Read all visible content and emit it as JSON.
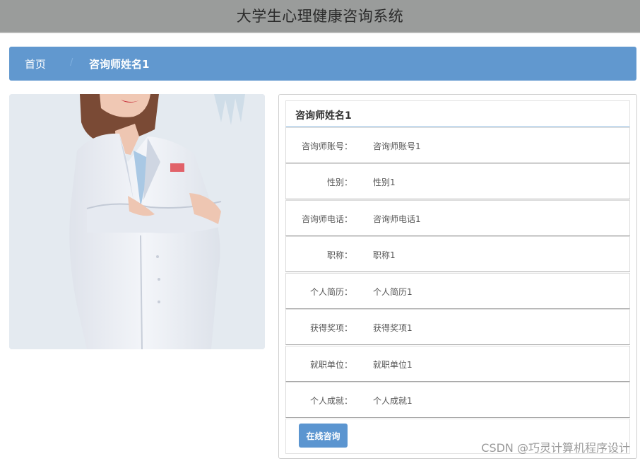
{
  "header": {
    "title": "大学生心理健康咨询系统"
  },
  "breadcrumb": {
    "home": "首页",
    "separator": "/",
    "current": "咨询师姓名1"
  },
  "profile": {
    "name": "咨询师姓名1",
    "fields": [
      {
        "label": "咨询师账号：",
        "value": "咨询师账号1"
      },
      {
        "label": "性别：",
        "value": "性别1"
      },
      {
        "label": "咨询师电话：",
        "value": "咨询师电话1"
      },
      {
        "label": "职称：",
        "value": "职称1"
      },
      {
        "label": "个人简历：",
        "value": "个人简历1"
      },
      {
        "label": "获得奖项：",
        "value": "获得奖项1"
      },
      {
        "label": "就职单位：",
        "value": "就职单位1"
      },
      {
        "label": "个人成就：",
        "value": "个人成就1"
      }
    ],
    "consult_button": "在线咨询"
  },
  "watermark": "CSDN @巧灵计算机程序设计",
  "colors": {
    "header_bg": "#9a9c9b",
    "breadcrumb_bg": "#6198cf",
    "button_bg": "#5b95d0"
  }
}
